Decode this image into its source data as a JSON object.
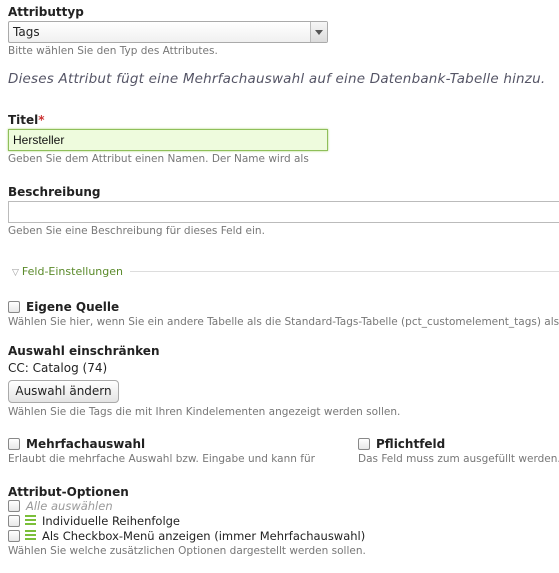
{
  "attribute_type": {
    "label": "Attributtyp",
    "value": "Tags",
    "help": "Bitte wählen Sie den Typ des Attributes."
  },
  "intro_text": "Dieses Attribut fügt eine Mehrfachauswahl auf eine Datenbank-Tabelle hinzu.",
  "title_field": {
    "label": "Titel",
    "required_mark": "*",
    "value": "Hersteller",
    "help": "Geben Sie dem Attribut einen Namen. Der Name wird als"
  },
  "description_field": {
    "label": "Beschreibung",
    "value": "",
    "help": "Geben Sie eine Beschreibung für dieses Feld ein."
  },
  "fieldset": {
    "legend": "Feld-Einstellungen"
  },
  "own_source": {
    "label": "Eigene Quelle",
    "checked": false,
    "help": "Wählen Sie hier, wenn Sie ein andere Tabelle als die Standard-Tags-Tabelle (pct_customelement_tags) als Q"
  },
  "restrict_selection": {
    "label": "Auswahl einschränken",
    "value": "CC: Catalog (74)",
    "button": "Auswahl ändern",
    "help": "Wählen Sie die Tags die mit Ihren Kindelementen angezeigt werden sollen."
  },
  "multi_select": {
    "label": "Mehrfachauswahl",
    "checked": false,
    "help": "Erlaubt die mehrfache Auswahl bzw. Eingabe und kann für"
  },
  "mandatory": {
    "label": "Pflichtfeld",
    "checked": false,
    "help": "Das Feld muss zum ausgefüllt werden."
  },
  "attribute_options": {
    "label": "Attribut-Optionen",
    "select_all": "Alle auswählen",
    "options": [
      {
        "label": "Individuelle Reihenfolge",
        "checked": false
      },
      {
        "label": "Als Checkbox-Menü anzeigen (immer Mehrfachauswahl)",
        "checked": false
      }
    ],
    "help": "Wählen Sie welche zusätzlichen Optionen dargestellt werden sollen."
  },
  "colors": {
    "active_input_bg": "#eefbdd",
    "active_input_border": "#8fbf5a",
    "legend_green": "#5a8a2a",
    "required_red": "#cc3333"
  },
  "icons": {
    "select_arrow": "chevron-down-icon",
    "legend_toggle": "triangle-down-icon",
    "drag_handle": "drag-handle-icon"
  }
}
